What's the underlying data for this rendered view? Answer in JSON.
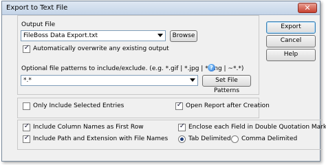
{
  "window": {
    "title": "Export to Text File",
    "close_glyph": "✕"
  },
  "output": {
    "label": "Output File",
    "file_value": "FileBoss Data Export.txt",
    "browse_label": "Browse",
    "auto_overwrite": {
      "label": "Automatically overwrite any existing output",
      "checked": true
    }
  },
  "patterns": {
    "label": "Optional file patterns to include/exclude.  (e.g. *.gif | *.jpg | *.png | ~*.*)",
    "value": "*.*",
    "set_button": "Set File Patterns",
    "help_glyph": "?"
  },
  "options": {
    "only_selected": {
      "label": "Only Include Selected Entries",
      "checked": false
    },
    "open_report": {
      "label": "Open Report after Creation",
      "checked": true
    },
    "column_names": {
      "label": "Include Column Names as First Row",
      "checked": true
    },
    "path_ext": {
      "label": "Include Path and Extension with File Names",
      "checked": true
    },
    "enclose_quotes": {
      "label": "Enclose each Field in Double Quotation Marks",
      "checked": true
    }
  },
  "delimiter": {
    "tab_label": "Tab Delimited",
    "comma_label": "Comma Delimited",
    "selected": "tab"
  },
  "buttons": {
    "export": "Export",
    "cancel": "Cancel",
    "help": "Help"
  },
  "check_glyph": "✓"
}
